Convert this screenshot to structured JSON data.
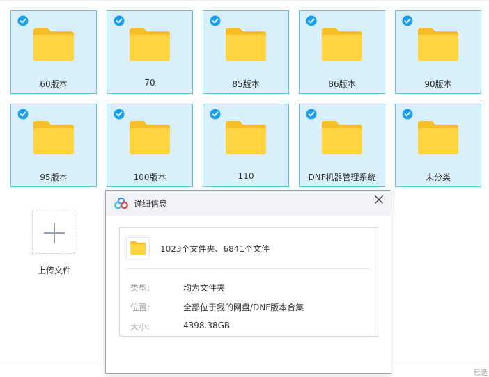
{
  "folders": [
    {
      "name": "60版本",
      "selected": true
    },
    {
      "name": "70",
      "selected": true
    },
    {
      "name": "85版本",
      "selected": true
    },
    {
      "name": "86版本",
      "selected": true
    },
    {
      "name": "90版本",
      "selected": true
    },
    {
      "name": "95版本",
      "selected": true
    },
    {
      "name": "100版本",
      "selected": true
    },
    {
      "name": "110",
      "selected": true
    },
    {
      "name": "DNF机器管理系统",
      "selected": true
    },
    {
      "name": "未分类",
      "selected": true
    }
  ],
  "upload": {
    "label": "上传文件"
  },
  "footer": {
    "text": "已选"
  },
  "dialog": {
    "title": "详细信息",
    "summary": "1023个文件夹、6841个文件",
    "rows": [
      {
        "key": "类型:",
        "value": "均为文件夹"
      },
      {
        "key": "位置:",
        "value": "全部位于我的网盘/DNF版本合集"
      },
      {
        "key": "大小:",
        "value": "4398.38GB"
      }
    ]
  },
  "colors": {
    "tile_bg": "#d7f0fb",
    "tile_border": "#5ac3ec",
    "check": "#1a9ff0",
    "folder": "#ffd342",
    "folder_back": "#f7be28"
  }
}
